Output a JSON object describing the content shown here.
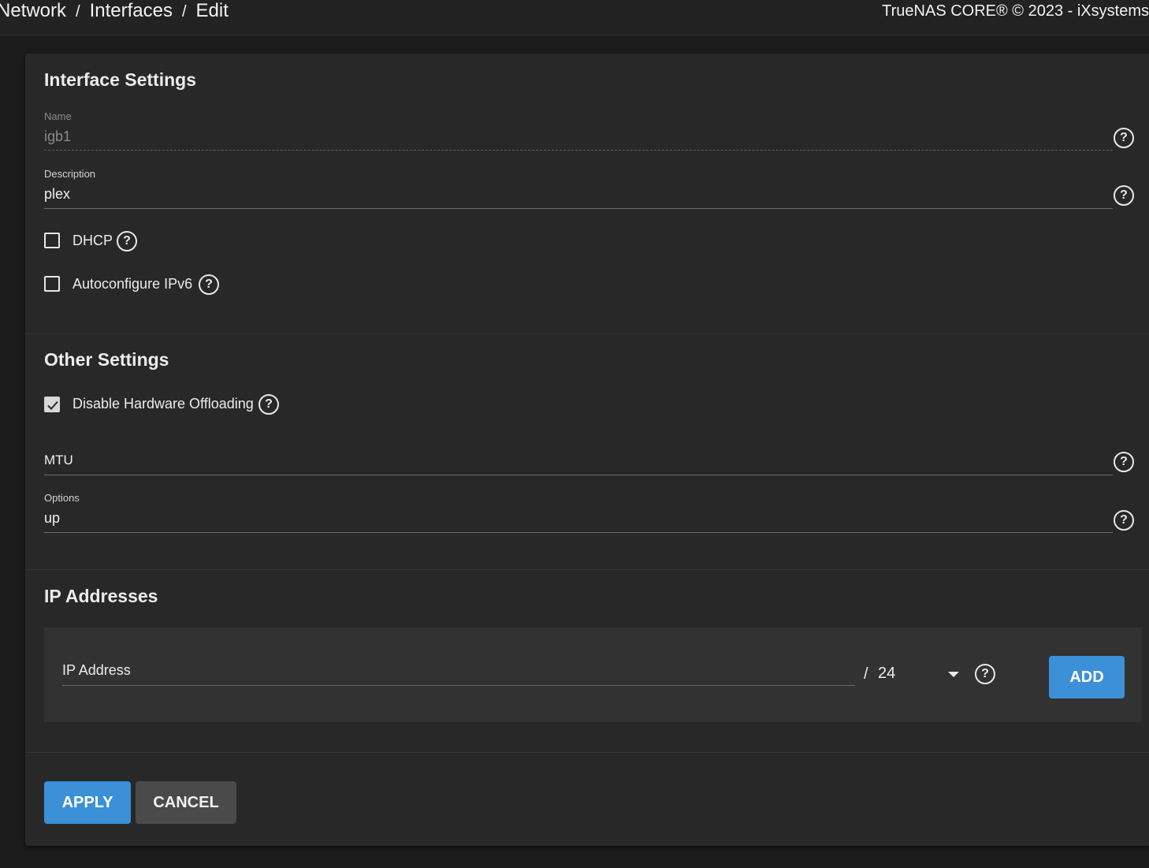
{
  "breadcrumb": {
    "items": [
      "Network",
      "Interfaces",
      "Edit"
    ],
    "separator": "/"
  },
  "header": {
    "copyright": "TrueNAS CORE® © 2023 - iXsystems"
  },
  "interface_settings": {
    "title": "Interface Settings",
    "name": {
      "label": "Name",
      "value": "igb1",
      "disabled": true
    },
    "description": {
      "label": "Description",
      "value": "plex"
    },
    "dhcp": {
      "label": "DHCP",
      "checked": false
    },
    "autoconfigure_ipv6": {
      "label": "Autoconfigure IPv6",
      "checked": false
    }
  },
  "other_settings": {
    "title": "Other Settings",
    "disable_hw_offloading": {
      "label": "Disable Hardware Offloading",
      "checked": true
    },
    "mtu": {
      "label": "MTU",
      "value": ""
    },
    "options": {
      "label": "Options",
      "value": "up"
    }
  },
  "ip_addresses": {
    "title": "IP Addresses",
    "ip_address": {
      "label": "IP Address",
      "value": ""
    },
    "netmask_separator": "/",
    "netmask": "24",
    "add_label": "ADD"
  },
  "actions": {
    "apply_label": "APPLY",
    "cancel_label": "CANCEL"
  },
  "colors": {
    "accent": "#3b90d8",
    "card_background": "#282828",
    "page_background": "#1b1b1b"
  },
  "icons": {
    "help": "help-circle-icon",
    "checkmark": "checkmark-icon",
    "dropdown": "caret-down-icon"
  }
}
